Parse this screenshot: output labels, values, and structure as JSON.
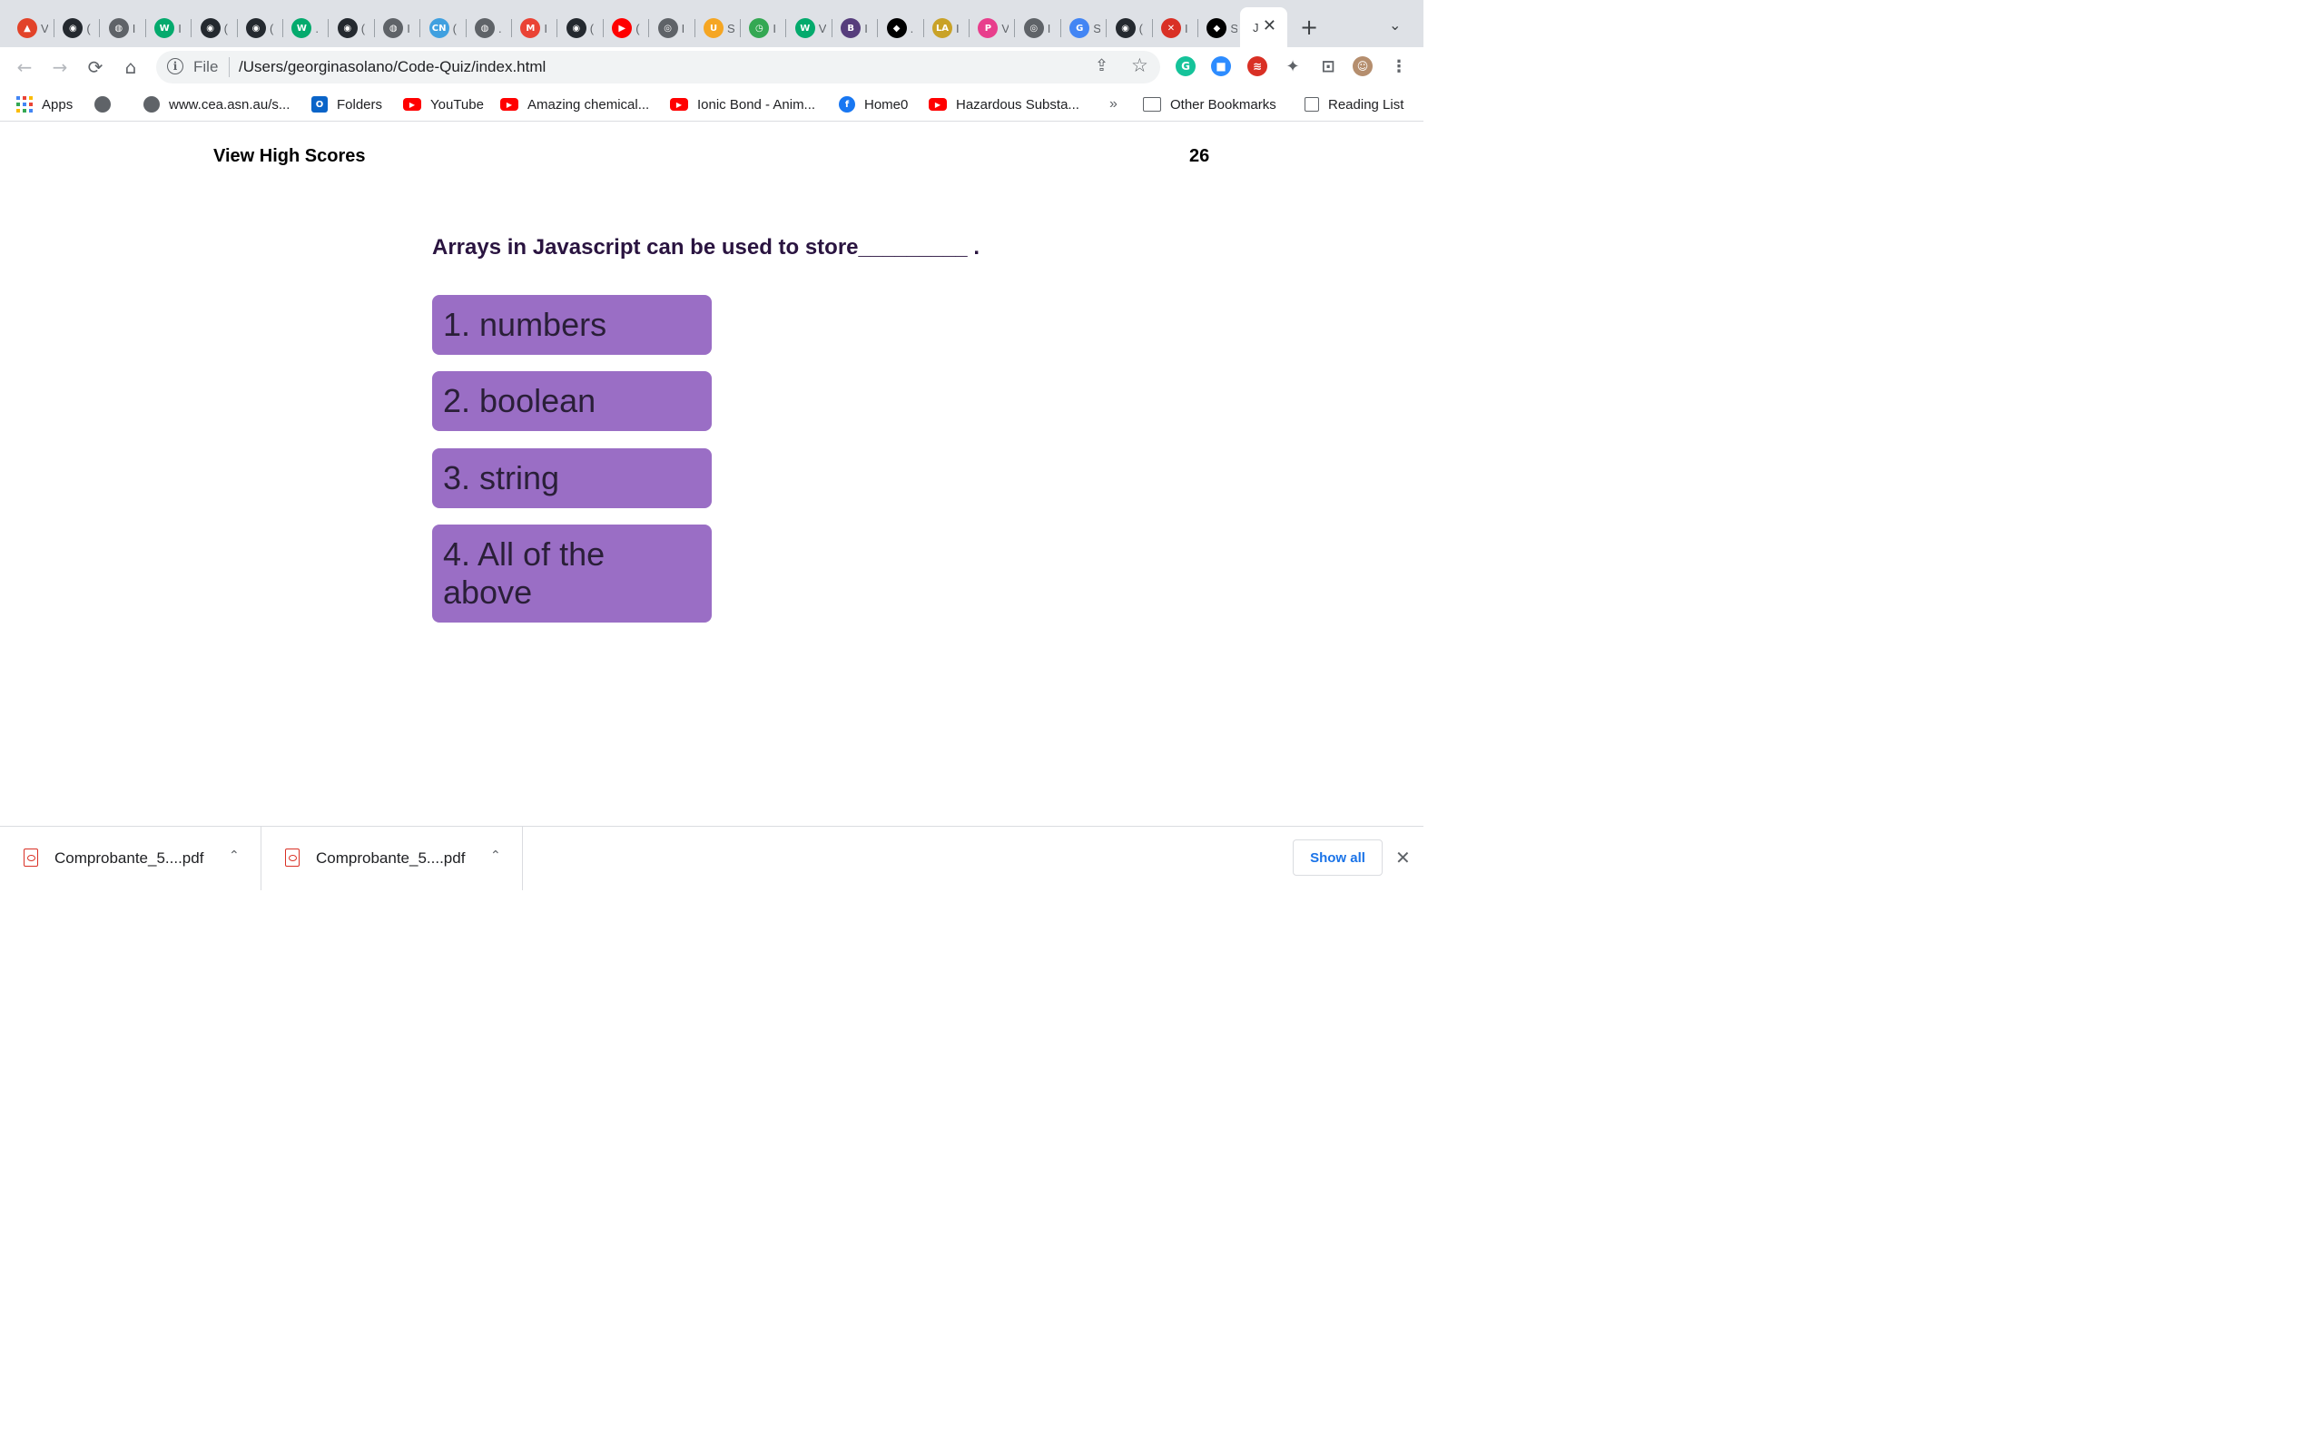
{
  "browser": {
    "tabs": [
      {
        "icon": "gitlab-icon",
        "color": "#e24329",
        "glyph": "▲",
        "label": "V"
      },
      {
        "icon": "github-icon",
        "color": "#24292f",
        "glyph": "◉",
        "label": "("
      },
      {
        "icon": "globe-icon",
        "color": "#5f6368",
        "glyph": "◍",
        "label": "I"
      },
      {
        "icon": "w3schools-icon",
        "color": "#04aa6d",
        "glyph": "W",
        "label": "I"
      },
      {
        "icon": "github-icon",
        "color": "#24292f",
        "glyph": "◉",
        "label": "("
      },
      {
        "icon": "github-icon",
        "color": "#24292f",
        "glyph": "◉",
        "label": "("
      },
      {
        "icon": "w3schools-icon",
        "color": "#04aa6d",
        "glyph": "W",
        "label": "."
      },
      {
        "icon": "github-icon",
        "color": "#24292f",
        "glyph": "◉",
        "label": "("
      },
      {
        "icon": "globe-icon",
        "color": "#5f6368",
        "glyph": "◍",
        "label": "I"
      },
      {
        "icon": "cn-icon",
        "color": "#3fa0e0",
        "glyph": "CN",
        "label": "("
      },
      {
        "icon": "globe-icon",
        "color": "#5f6368",
        "glyph": "◍",
        "label": "."
      },
      {
        "icon": "gmail-icon",
        "color": "#ea4335",
        "glyph": "M",
        "label": "I"
      },
      {
        "icon": "github-icon",
        "color": "#24292f",
        "glyph": "◉",
        "label": "("
      },
      {
        "icon": "youtube-icon",
        "color": "#ff0000",
        "glyph": "▶",
        "label": "("
      },
      {
        "icon": "chrome-icon",
        "color": "#5f6368",
        "glyph": "◎",
        "label": "I"
      },
      {
        "icon": "shield-icon",
        "color": "#f5a623",
        "glyph": "U",
        "label": "S"
      },
      {
        "icon": "clock-icon",
        "color": "#34a853",
        "glyph": "◷",
        "label": "I"
      },
      {
        "icon": "w3schools-icon",
        "color": "#04aa6d",
        "glyph": "W",
        "label": "V"
      },
      {
        "icon": "bootstrap-icon",
        "color": "#563d7c",
        "glyph": "B",
        "label": "I"
      },
      {
        "icon": "codepen-icon",
        "color": "#000000",
        "glyph": "◆",
        "label": "."
      },
      {
        "icon": "lavt-icon",
        "color": "#c9a227",
        "glyph": "LA",
        "label": "I"
      },
      {
        "icon": "p-icon",
        "color": "#e83e8c",
        "glyph": "P",
        "label": "V"
      },
      {
        "icon": "chrome-icon",
        "color": "#5f6368",
        "glyph": "◎",
        "label": "I"
      },
      {
        "icon": "google-icon",
        "color": "#4285f4",
        "glyph": "G",
        "label": "S"
      },
      {
        "icon": "github-icon",
        "color": "#24292f",
        "glyph": "◉",
        "label": "("
      },
      {
        "icon": "tools-icon",
        "color": "#d93025",
        "glyph": "✕",
        "label": "I"
      },
      {
        "icon": "codepen-icon",
        "color": "#000000",
        "glyph": "◆",
        "label": "S"
      }
    ],
    "active_tab": {
      "label": "J",
      "close": "✕"
    },
    "new_tab": "+",
    "tab_search": "⌄",
    "nav": {
      "back": "←",
      "forward": "→",
      "reload": "⟳",
      "home": "⌂"
    },
    "address": {
      "info": "i",
      "scheme": "File",
      "url": "/Users/georginasolano/Code-Quiz/index.html",
      "share": "⇪",
      "star": "☆"
    },
    "extensions": [
      {
        "icon": "grammarly-icon",
        "color": "#15c39a",
        "glyph": "G"
      },
      {
        "icon": "zoom-icon",
        "color": "#2d8cff",
        "glyph": "■"
      },
      {
        "icon": "extension-badge-icon",
        "color": "#d93025",
        "glyph": "≋"
      },
      {
        "icon": "puzzle-icon",
        "color": "#5f6368",
        "glyph": "✦"
      },
      {
        "icon": "cast-icon",
        "color": "#5f6368",
        "glyph": "⊡"
      },
      {
        "icon": "profile-avatar-icon",
        "color": "#b58e6e",
        "glyph": "☺"
      },
      {
        "icon": "menu-kebab-icon",
        "color": "#5f6368",
        "glyph": "⋮"
      }
    ],
    "bookmarks": [
      {
        "label": "Apps"
      },
      {
        "label": ""
      },
      {
        "label": "www.cea.asn.au/s..."
      },
      {
        "label": "Folders"
      },
      {
        "label": "YouTube"
      },
      {
        "label": "Amazing chemical..."
      },
      {
        "label": "Ionic Bond - Anim..."
      },
      {
        "label": "Home0"
      },
      {
        "label": "Hazardous Substa..."
      }
    ],
    "bookmarks_overflow": "»",
    "other_bookmarks": "Other Bookmarks",
    "reading_list": "Reading List"
  },
  "quiz": {
    "view_high_scores": "View High Scores",
    "timer": "26",
    "question": "Arrays in Javascript can be used to store_________ .",
    "choices": [
      "1. numbers",
      "2. boolean",
      "3. string",
      "4. All of the above"
    ]
  },
  "downloads": {
    "items": [
      {
        "name": "Comprobante_5....pdf"
      },
      {
        "name": "Comprobante_5....pdf"
      }
    ],
    "chevron": "⌃",
    "show_all": "Show all",
    "close": "✕"
  },
  "colors": {
    "choice_bg": "#9a6ec5",
    "question_text": "#2a1440",
    "link_blue": "#1a73e8"
  }
}
